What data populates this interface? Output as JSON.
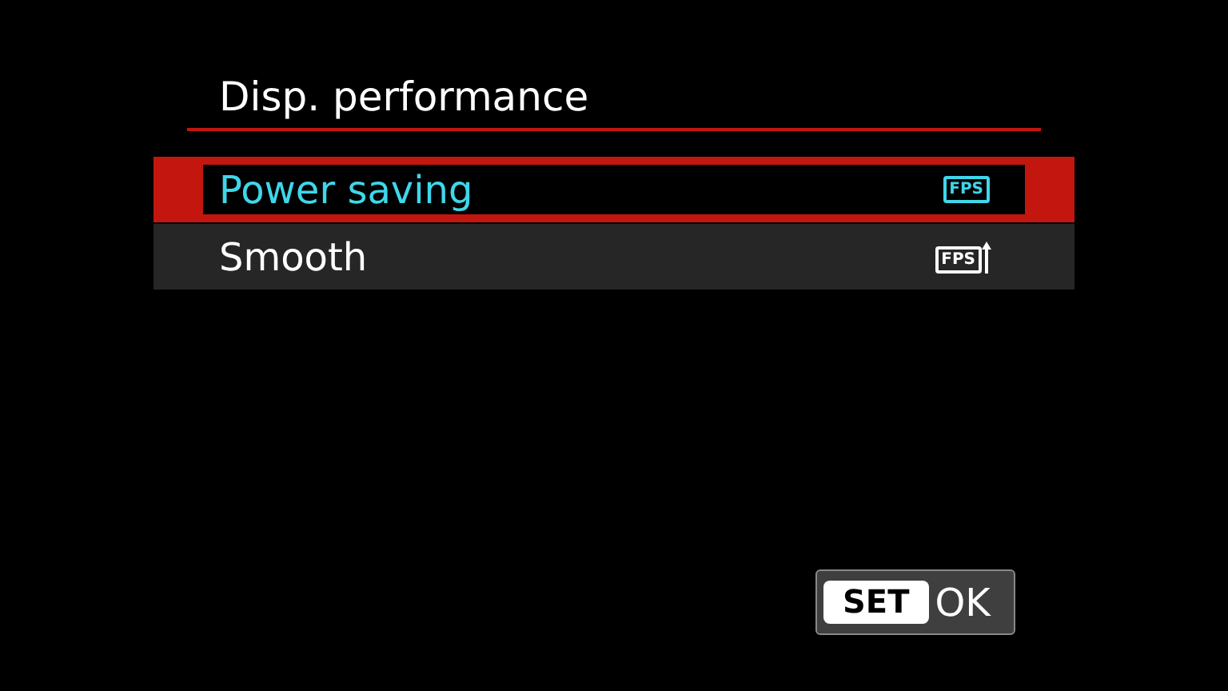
{
  "title": "Disp. performance",
  "items": [
    {
      "label": "Power saving",
      "icon_text": "FPS",
      "kind": "plain",
      "selected": true
    },
    {
      "label": "Smooth",
      "icon_text": "FPS",
      "kind": "boost",
      "selected": false
    }
  ],
  "ok_button": {
    "key": "SET",
    "label": "OK"
  }
}
